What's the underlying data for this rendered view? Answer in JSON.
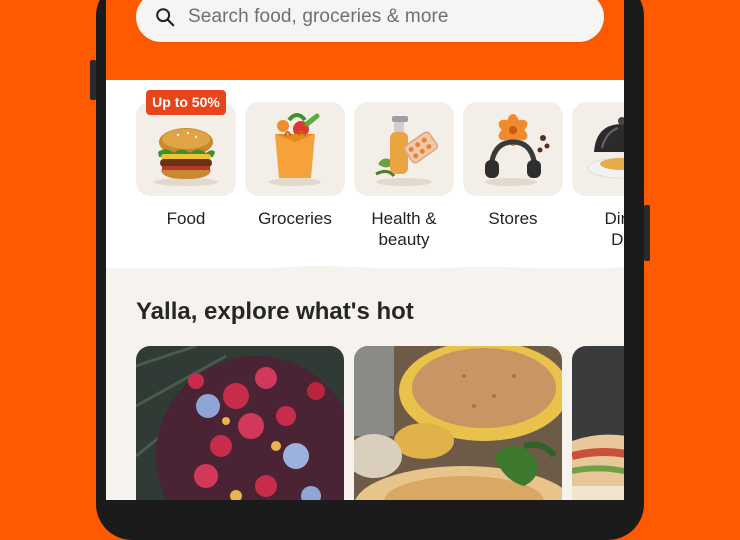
{
  "search": {
    "placeholder": "Search food, groceries & more",
    "icon": "search-icon"
  },
  "categories": {
    "promo_badge": "Up to 50%",
    "items": [
      {
        "label": "Food",
        "icon": "burger-icon"
      },
      {
        "label": "Groceries",
        "icon": "grocery-bag-icon"
      },
      {
        "label": "Health &\nbeauty",
        "icon": "health-beauty-icon"
      },
      {
        "label": "Stores",
        "icon": "headphones-flower-icon"
      },
      {
        "label": "Dine\nDe",
        "icon": "dining-cloche-icon"
      }
    ]
  },
  "explore": {
    "title": "Yalla, explore what's hot",
    "cards": [
      {
        "icon": "berry-bowl-image"
      },
      {
        "icon": "spice-dish-image"
      },
      {
        "icon": "wrap-image"
      }
    ]
  },
  "colors": {
    "brand": "#FF5A00",
    "badge": "#E8451B",
    "tile": "#F3EEE7"
  }
}
